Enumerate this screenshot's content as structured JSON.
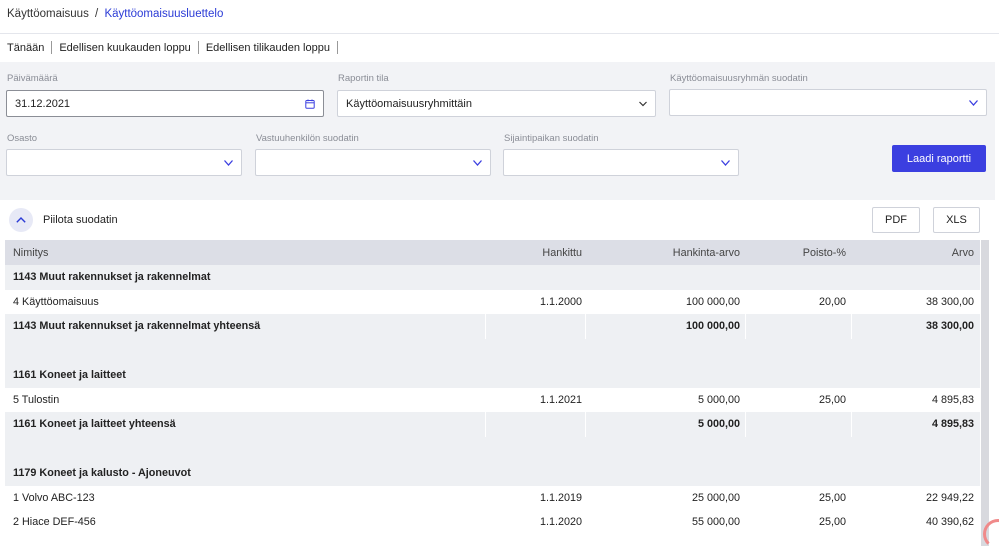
{
  "breadcrumb": {
    "parent": "Käyttöomaisuus",
    "separator": "/",
    "current": "Käyttöomaisuusluettelo"
  },
  "quick_dates": [
    "Tänään",
    "Edellisen kuukauden loppu",
    "Edellisen tilikauden loppu"
  ],
  "filters": {
    "date_label": "Päivämäärä",
    "date_value": "31.12.2021",
    "report_state_label": "Raportin tila",
    "report_state_value": "Käyttöomaisuusryhmittäin",
    "group_filter_label": "Käyttöomaisuusryhmän suodatin",
    "group_filter_value": "",
    "department_label": "Osasto",
    "department_value": "",
    "responsible_label": "Vastuuhenkilön suodatin",
    "responsible_value": "",
    "location_label": "Sijaintipaikan suodatin",
    "location_value": "",
    "generate_button": "Laadi raportti"
  },
  "toolbar": {
    "hide_filter": "Piilota suodatin",
    "pdf": "PDF",
    "xls": "XLS"
  },
  "table": {
    "columns": [
      "Nimitys",
      "Hankittu",
      "Hankinta-arvo",
      "Poisto-%",
      "Arvo"
    ],
    "rows": [
      {
        "type": "group",
        "name": "1143 Muut rakennukset ja rakennelmat",
        "date": "",
        "cost": "",
        "pct": "",
        "value": ""
      },
      {
        "type": "item",
        "name": "4 Käyttöomaisuus",
        "date": "1.1.2000",
        "cost": "100 000,00",
        "pct": "20,00",
        "value": "38 300,00"
      },
      {
        "type": "total",
        "name": "1143 Muut rakennukset ja rakennelmat yhteensä",
        "date": "",
        "cost": "100 000,00",
        "pct": "",
        "value": "38 300,00"
      },
      {
        "type": "empty",
        "name": "",
        "date": "",
        "cost": "",
        "pct": "",
        "value": ""
      },
      {
        "type": "group",
        "name": "1161 Koneet ja laitteet",
        "date": "",
        "cost": "",
        "pct": "",
        "value": ""
      },
      {
        "type": "item",
        "name": "5 Tulostin",
        "date": "1.1.2021",
        "cost": "5 000,00",
        "pct": "25,00",
        "value": "4 895,83"
      },
      {
        "type": "total",
        "name": "1161 Koneet ja laitteet yhteensä",
        "date": "",
        "cost": "5 000,00",
        "pct": "",
        "value": "4 895,83"
      },
      {
        "type": "empty",
        "name": "",
        "date": "",
        "cost": "",
        "pct": "",
        "value": ""
      },
      {
        "type": "group",
        "name": "1179 Koneet ja kalusto - Ajoneuvot",
        "date": "",
        "cost": "",
        "pct": "",
        "value": ""
      },
      {
        "type": "item",
        "name": "1 Volvo ABC-123",
        "date": "1.1.2019",
        "cost": "25 000,00",
        "pct": "25,00",
        "value": "22 949,22"
      },
      {
        "type": "item",
        "name": "2 Hiace DEF-456",
        "date": "1.1.2020",
        "cost": "55 000,00",
        "pct": "25,00",
        "value": "40 390,62"
      }
    ]
  },
  "colors": {
    "accent": "#3b3fe0",
    "link": "#2b3bd6",
    "filter_bg": "#f2f3f6",
    "header_bg": "#dcdee6",
    "group_bg": "#eef0f3"
  },
  "icons": {
    "calendar": "calendar-icon",
    "dropdown": "chevron-down-icon",
    "collapse": "chevron-up-icon"
  }
}
